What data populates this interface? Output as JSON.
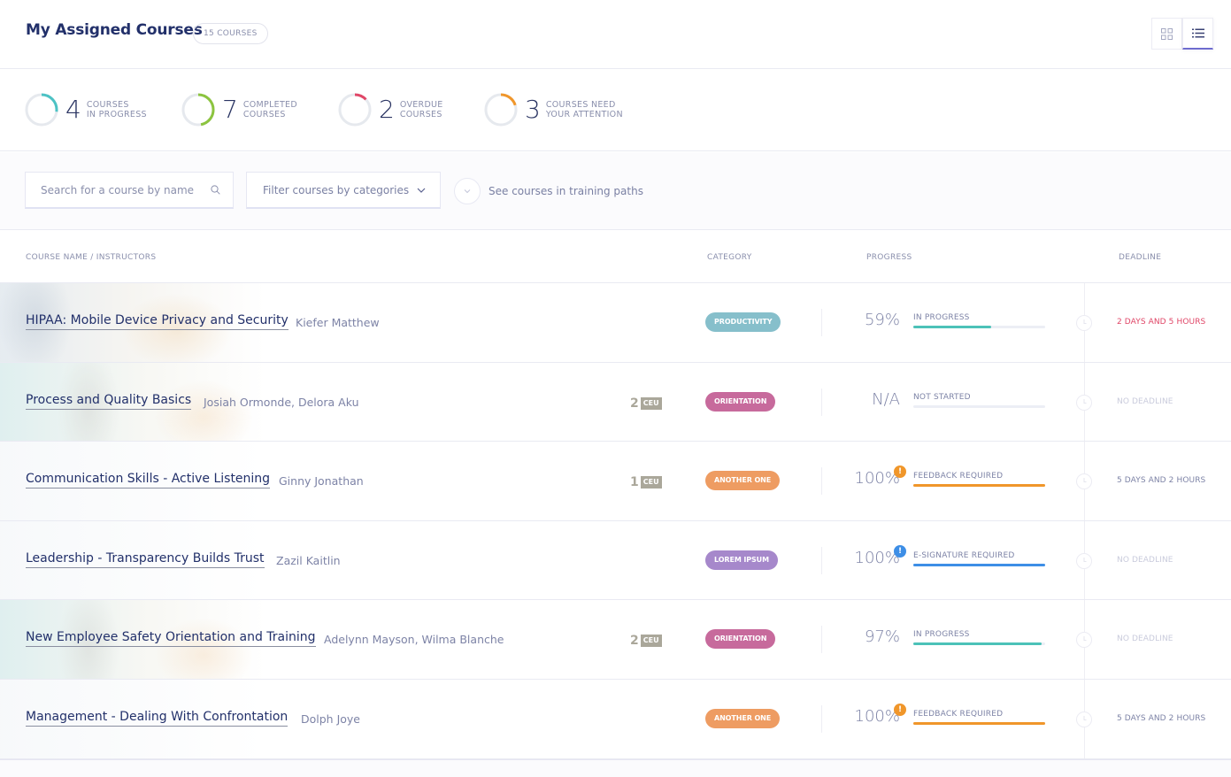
{
  "header": {
    "title": "My Assigned Courses",
    "count_label": "15 COURSES",
    "view_toggle": [
      {
        "label": "grid-view",
        "icon": "grid-icon",
        "active": false
      },
      {
        "label": "list-view",
        "icon": "list-icon",
        "active": true
      }
    ]
  },
  "stats": [
    {
      "value": "4",
      "label_line1": "COURSES",
      "label_line2": "IN PROGRESS",
      "color": "#4cc2c4",
      "fraction": 0.27
    },
    {
      "value": "7",
      "label_line1": "COMPLETED",
      "label_line2": "COURSES",
      "color": "#8cc43f",
      "fraction": 0.47
    },
    {
      "value": "2",
      "label_line1": "OVERDUE",
      "label_line2": "COURSES",
      "color": "#e04667",
      "fraction": 0.13
    },
    {
      "value": "3",
      "label_line1": "COURSES NEED",
      "label_line2": "YOUR ATTENTION",
      "color": "#f0962a",
      "fraction": 0.2
    }
  ],
  "filters": {
    "search_placeholder": "Search for a course by name",
    "category_select": "Filter courses by categories",
    "training_paths_label": "See courses in training paths"
  },
  "table": {
    "columns": {
      "course": "COURSE NAME / INSTRUCTORS",
      "category": "CATEGORY",
      "progress": "PROGRESS",
      "deadline": "DEADLINE"
    },
    "rows": [
      {
        "name": "HIPAA: Mobile Device Privacy and Security",
        "instructors": "Kiefer Matthew",
        "ceu": null,
        "category": "PRODUCTIVITY",
        "category_color": "#86bfcb",
        "progress_text": "59%",
        "progress": 0.59,
        "status": "IN PROGRESS",
        "bar_color": "#4cc2b8",
        "alert": null,
        "deadline": "2 DAYS AND 5 HOURS",
        "deadline_color": "#e04667",
        "bg": "photo"
      },
      {
        "name": "Process and Quality Basics",
        "instructors": "Josiah Ormonde, Delora Aku",
        "ceu": "2",
        "category": "ORIENTATION",
        "category_color": "#c76a9c",
        "progress_text": "N/A",
        "progress": 0,
        "status": "NOT STARTED",
        "bar_color": "#4cc2b8",
        "alert": null,
        "deadline": "NO DEADLINE",
        "deadline_color": "#c9cbdc",
        "bg": "photo2"
      },
      {
        "name": "Communication Skills - Active Listening",
        "instructors": "Ginny Jonathan",
        "ceu": "1",
        "category": "ANOTHER ONE",
        "category_color": "#ee9c62",
        "progress_text": "100%",
        "progress": 1.0,
        "status": "FEEDBACK REQUIRED",
        "bar_color": "#f0962a",
        "alert": {
          "glyph": "!",
          "color": "#f0962a"
        },
        "deadline": "5 DAYS AND 2 HOURS",
        "deadline_color": "#7d83a6",
        "bg": "faint"
      },
      {
        "name": "Leadership - Transparency Builds Trust",
        "instructors": "Zazil Kaitlin",
        "ceu": null,
        "category": "LOREM IPSUM",
        "category_color": "#a688cb",
        "progress_text": "100%",
        "progress": 1.0,
        "status": "E-SIGNATURE REQUIRED",
        "bar_color": "#3d8ee6",
        "alert": {
          "glyph": "!",
          "color": "#3d8ee6"
        },
        "deadline": "NO DEADLINE",
        "deadline_color": "#c9cbdc",
        "bg": "faint"
      },
      {
        "name": "New Employee Safety Orientation and Training",
        "instructors": "Adelynn Mayson, Wilma Blanche",
        "ceu": "2",
        "category": "ORIENTATION",
        "category_color": "#c76a9c",
        "progress_text": "97%",
        "progress": 0.97,
        "status": "IN PROGRESS",
        "bar_color": "#4cc2b8",
        "alert": null,
        "deadline": "NO DEADLINE",
        "deadline_color": "#c9cbdc",
        "bg": "photo2"
      },
      {
        "name": "Management - Dealing With Confrontation",
        "instructors": "Dolph Joye",
        "ceu": null,
        "category": "ANOTHER ONE",
        "category_color": "#ee9c62",
        "progress_text": "100%",
        "progress": 1.0,
        "status": "FEEDBACK REQUIRED",
        "bar_color": "#f0962a",
        "alert": {
          "glyph": "!",
          "color": "#f0962a"
        },
        "deadline": "5 DAYS AND 2 HOURS",
        "deadline_color": "#7d83a6",
        "bg": "faint"
      }
    ],
    "ceu_tag": "CEU"
  }
}
